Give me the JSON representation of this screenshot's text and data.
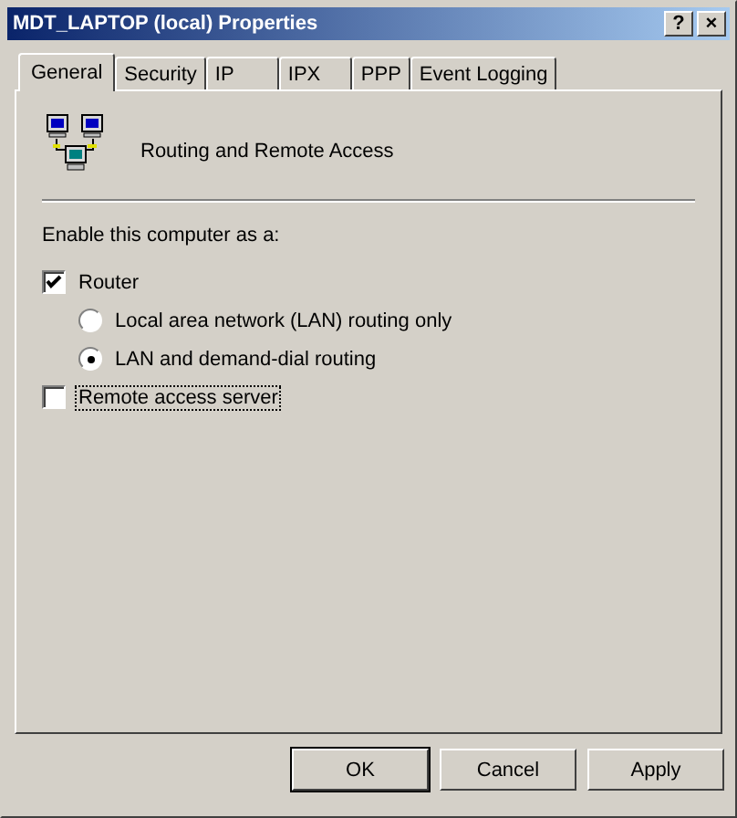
{
  "window": {
    "title": "MDT_LAPTOP (local) Properties",
    "buttons": [
      "?",
      "×"
    ]
  },
  "tabs": [
    {
      "label": "General",
      "selected": true
    },
    {
      "label": "Security",
      "selected": false
    },
    {
      "label": "IP",
      "selected": false
    },
    {
      "label": "IPX",
      "selected": false
    },
    {
      "label": "PPP",
      "selected": false
    },
    {
      "label": "Event Logging",
      "selected": false
    }
  ],
  "header": {
    "title": "Routing and Remote Access"
  },
  "group_label": "Enable this computer as a:",
  "options": [
    {
      "kind": "checkbox",
      "label": "Router",
      "checked": true,
      "focused": false
    },
    {
      "kind": "radio",
      "label": "Local area network (LAN) routing only",
      "selected": false
    },
    {
      "kind": "radio",
      "label": "LAN and demand-dial routing",
      "selected": true
    },
    {
      "kind": "checkbox",
      "label": "Remote access server",
      "checked": false,
      "focused": true
    }
  ],
  "buttons": [
    {
      "label": "OK",
      "default": true
    },
    {
      "label": "Cancel",
      "default": false
    },
    {
      "label": "Apply",
      "default": false
    }
  ]
}
